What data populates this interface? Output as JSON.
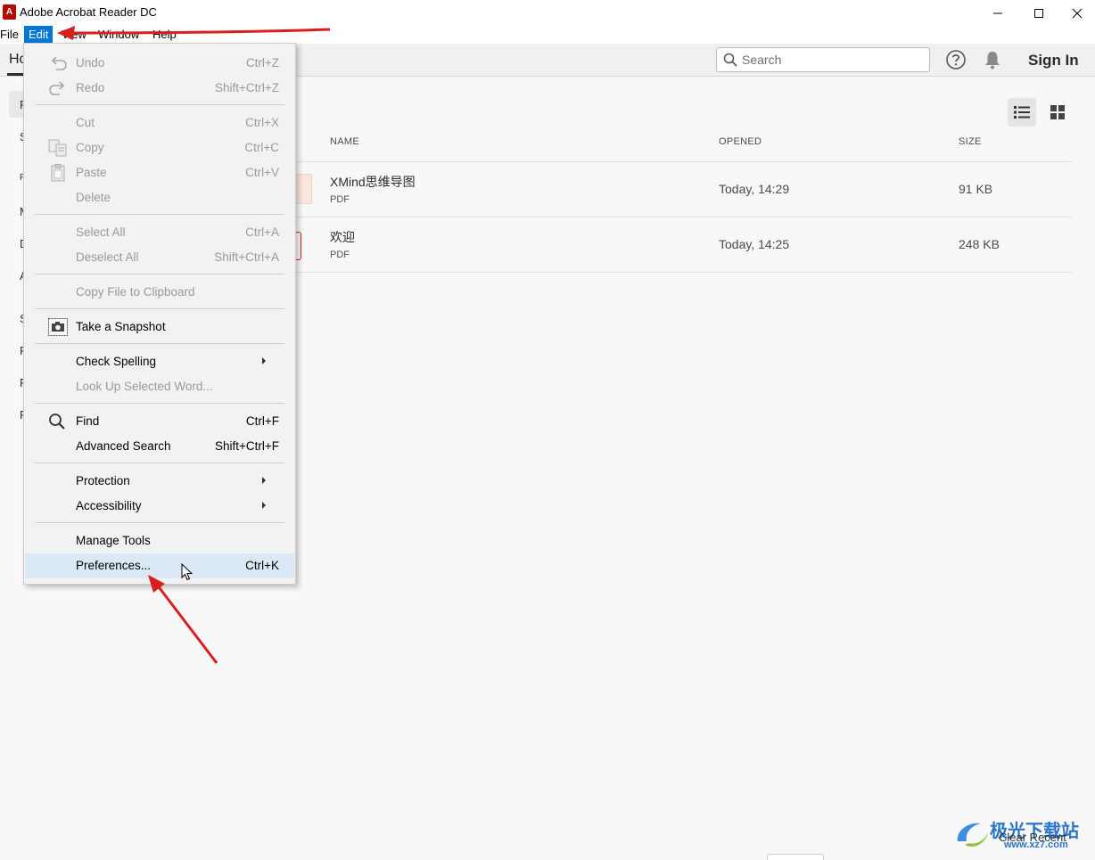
{
  "window": {
    "title": "Adobe Acrobat Reader DC",
    "logo_letter": "A"
  },
  "menubar": {
    "items": [
      "File",
      "Edit",
      "View",
      "Window",
      "Help"
    ],
    "active": "Edit"
  },
  "toolbar": {
    "tab_home": "Ho",
    "search_placeholder": "Search",
    "sign_in": "Sign In"
  },
  "left_nav": {
    "letters": [
      "R",
      "S",
      "F",
      "M",
      "D",
      "A",
      "S",
      "P",
      "P",
      "P"
    ]
  },
  "files": {
    "headers": {
      "name": "NAME",
      "opened": "OPENED",
      "size": "SIZE"
    },
    "rows": [
      {
        "name": "XMind思维导图",
        "type": "PDF",
        "opened": "Today, 14:29",
        "size": "91 KB"
      },
      {
        "name": "欢迎",
        "type": "PDF",
        "opened": "Today, 14:25",
        "size": "248 KB"
      }
    ]
  },
  "edit_menu": {
    "undo": {
      "label": "Undo",
      "shortcut": "Ctrl+Z"
    },
    "redo": {
      "label": "Redo",
      "shortcut": "Shift+Ctrl+Z"
    },
    "cut": {
      "label": "Cut",
      "shortcut": "Ctrl+X"
    },
    "copy": {
      "label": "Copy",
      "shortcut": "Ctrl+C"
    },
    "paste": {
      "label": "Paste",
      "shortcut": "Ctrl+V"
    },
    "delete": {
      "label": "Delete"
    },
    "select_all": {
      "label": "Select All",
      "shortcut": "Ctrl+A"
    },
    "deselect_all": {
      "label": "Deselect All",
      "shortcut": "Shift+Ctrl+A"
    },
    "copy_file": {
      "label": "Copy File to Clipboard"
    },
    "snapshot": {
      "label": "Take a Snapshot"
    },
    "check_spelling": {
      "label": "Check Spelling"
    },
    "look_up": {
      "label": "Look Up Selected Word..."
    },
    "find": {
      "label": "Find",
      "shortcut": "Ctrl+F"
    },
    "advanced_search": {
      "label": "Advanced Search",
      "shortcut": "Shift+Ctrl+F"
    },
    "protection": {
      "label": "Protection"
    },
    "accessibility": {
      "label": "Accessibility"
    },
    "manage_tools": {
      "label": "Manage Tools"
    },
    "preferences": {
      "label": "Preferences...",
      "shortcut": "Ctrl+K"
    }
  },
  "footer": {
    "clear_recent": "Clear Recent"
  },
  "watermark": {
    "text": "极光下载站",
    "url": "www.xz7.com"
  },
  "colors": {
    "accent": "#0078d7",
    "annotation_arrow": "#d81e1e",
    "acrobat_red": "#b30b00",
    "menu_hover": "#dbe8f5"
  }
}
